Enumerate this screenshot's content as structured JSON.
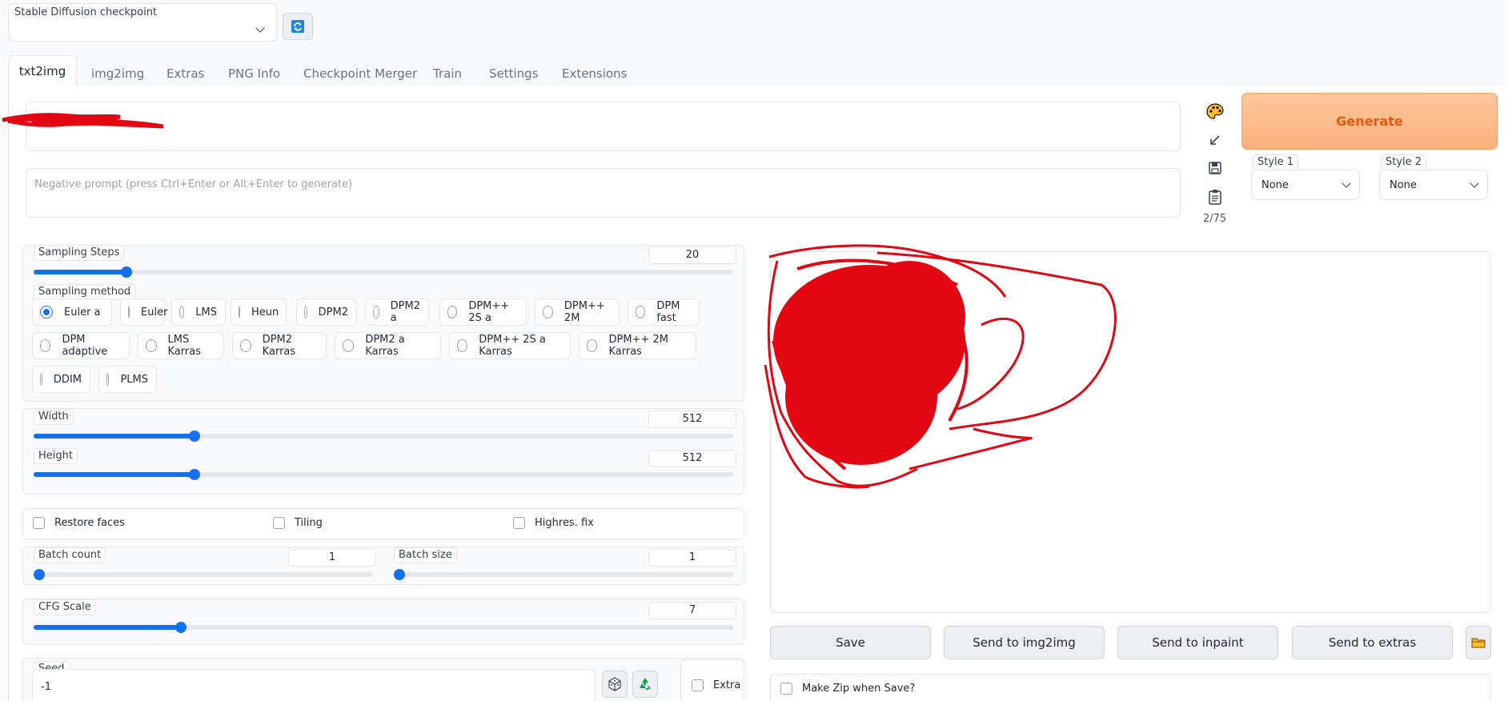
{
  "checkpoint": {
    "label": "Stable Diffusion checkpoint",
    "value": ""
  },
  "tabs": [
    "txt2img",
    "img2img",
    "Extras",
    "PNG Info",
    "Checkpoint Merger",
    "Train",
    "Settings",
    "Extensions"
  ],
  "active_tab": "txt2img",
  "prompt": {
    "value": ""
  },
  "negative_prompt": {
    "placeholder": "Negative prompt (press Ctrl+Enter or Alt+Enter to generate)"
  },
  "token_count": "2/75",
  "generate_label": "Generate",
  "styles": [
    {
      "label": "Style 1",
      "value": "None"
    },
    {
      "label": "Style 2",
      "value": "None"
    }
  ],
  "sampling_steps": {
    "label": "Sampling Steps",
    "value": "20",
    "min": 1,
    "max": 150
  },
  "sampling_method": {
    "label": "Sampling method",
    "selected": "Euler a",
    "options": [
      "Euler a",
      "Euler",
      "LMS",
      "Heun",
      "DPM2",
      "DPM2 a",
      "DPM++ 2S a",
      "DPM++ 2M",
      "DPM fast",
      "DPM adaptive",
      "LMS Karras",
      "DPM2 Karras",
      "DPM2 a Karras",
      "DPM++ 2S a Karras",
      "DPM++ 2M Karras",
      "DDIM",
      "PLMS"
    ]
  },
  "width": {
    "label": "Width",
    "value": "512",
    "min": 64,
    "max": 2048
  },
  "height": {
    "label": "Height",
    "value": "512",
    "min": 64,
    "max": 2048
  },
  "checkboxes": {
    "restore_faces": "Restore faces",
    "tiling": "Tiling",
    "highres_fix": "Highres. fix"
  },
  "batch_count": {
    "label": "Batch count",
    "value": "1",
    "min": 1,
    "max": 100
  },
  "batch_size": {
    "label": "Batch size",
    "value": "1",
    "min": 1,
    "max": 8
  },
  "cfg_scale": {
    "label": "CFG Scale",
    "value": "7",
    "min": 1,
    "max": 30
  },
  "seed": {
    "label": "Seed",
    "value": "-1",
    "extra_label": "Extra"
  },
  "output_buttons": [
    "Save",
    "Send to img2img",
    "Send to inpaint",
    "Send to extras"
  ],
  "make_zip_label": "Make Zip when Save?",
  "colors": {
    "accent": "#1570ef",
    "generate_bg": "#fdba8c",
    "generate_text": "#ea580c",
    "scribble": "#e30613"
  },
  "icons": {
    "refresh": "refresh-icon",
    "palette": "palette-icon",
    "arrow": "arrow-down-left-icon",
    "save": "floppy-disk-icon",
    "clipboard": "clipboard-icon",
    "dice": "dice-icon",
    "recycle": "recycle-icon",
    "folder": "folder-icon"
  }
}
